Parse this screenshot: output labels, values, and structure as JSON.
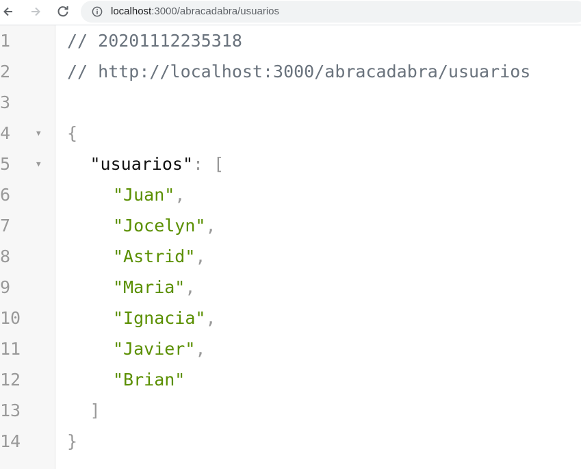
{
  "browser": {
    "url_host": "localhost",
    "url_path": ":3000/abracadabra/usuarios"
  },
  "editor": {
    "lines": [
      {
        "n": "1",
        "indent": 0,
        "fold": false,
        "tokens": [
          {
            "t": "comment",
            "v": "// 20201112235318"
          }
        ]
      },
      {
        "n": "2",
        "indent": 0,
        "fold": false,
        "tokens": [
          {
            "t": "comment",
            "v": "// http://localhost:3000/abracadabra/usuarios"
          }
        ]
      },
      {
        "n": "3",
        "indent": 0,
        "fold": false,
        "tokens": []
      },
      {
        "n": "4",
        "indent": 0,
        "fold": true,
        "tokens": [
          {
            "t": "punct",
            "v": "{"
          }
        ]
      },
      {
        "n": "5",
        "indent": 1,
        "fold": true,
        "tokens": [
          {
            "t": "key",
            "v": "\"usuarios\""
          },
          {
            "t": "punct",
            "v": ": ["
          }
        ]
      },
      {
        "n": "6",
        "indent": 2,
        "fold": false,
        "tokens": [
          {
            "t": "str",
            "v": "\"Juan\""
          },
          {
            "t": "punct",
            "v": ","
          }
        ]
      },
      {
        "n": "7",
        "indent": 2,
        "fold": false,
        "tokens": [
          {
            "t": "str",
            "v": "\"Jocelyn\""
          },
          {
            "t": "punct",
            "v": ","
          }
        ]
      },
      {
        "n": "8",
        "indent": 2,
        "fold": false,
        "tokens": [
          {
            "t": "str",
            "v": "\"Astrid\""
          },
          {
            "t": "punct",
            "v": ","
          }
        ]
      },
      {
        "n": "9",
        "indent": 2,
        "fold": false,
        "tokens": [
          {
            "t": "str",
            "v": "\"Maria\""
          },
          {
            "t": "punct",
            "v": ","
          }
        ]
      },
      {
        "n": "10",
        "indent": 2,
        "fold": false,
        "tokens": [
          {
            "t": "str",
            "v": "\"Ignacia\""
          },
          {
            "t": "punct",
            "v": ","
          }
        ]
      },
      {
        "n": "11",
        "indent": 2,
        "fold": false,
        "tokens": [
          {
            "t": "str",
            "v": "\"Javier\""
          },
          {
            "t": "punct",
            "v": ","
          }
        ]
      },
      {
        "n": "12",
        "indent": 2,
        "fold": false,
        "tokens": [
          {
            "t": "str",
            "v": "\"Brian\""
          }
        ]
      },
      {
        "n": "13",
        "indent": 1,
        "fold": false,
        "tokens": [
          {
            "t": "punct",
            "v": "]"
          }
        ]
      },
      {
        "n": "14",
        "indent": 0,
        "fold": false,
        "tokens": [
          {
            "t": "punct",
            "v": "}"
          }
        ]
      }
    ]
  },
  "icons": {
    "back": "arrow-left-icon",
    "forward": "arrow-right-icon",
    "reload": "reload-icon",
    "info": "info-icon",
    "fold": "fold-triangle-icon"
  },
  "colors": {
    "comment": "#6a737d",
    "string": "#5a8f00",
    "key": "#111111",
    "punctuation": "#999999",
    "gutter": "#f7f7f7",
    "omnibox": "#f1f3f4"
  }
}
